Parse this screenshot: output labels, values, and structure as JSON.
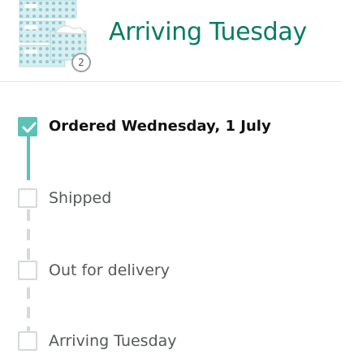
{
  "header": {
    "title": "Arriving Tuesday",
    "item_count": "2"
  },
  "colors": {
    "accent": "#067d62",
    "progress": "#5cc2b5",
    "pending": "#d5d9d9"
  },
  "timeline": {
    "steps": [
      {
        "label": "Ordered Wednesday, 1 July",
        "done": true
      },
      {
        "label": "Shipped",
        "done": false
      },
      {
        "label": "Out for delivery",
        "done": false
      },
      {
        "label": "Arriving Tuesday",
        "done": false
      }
    ]
  }
}
